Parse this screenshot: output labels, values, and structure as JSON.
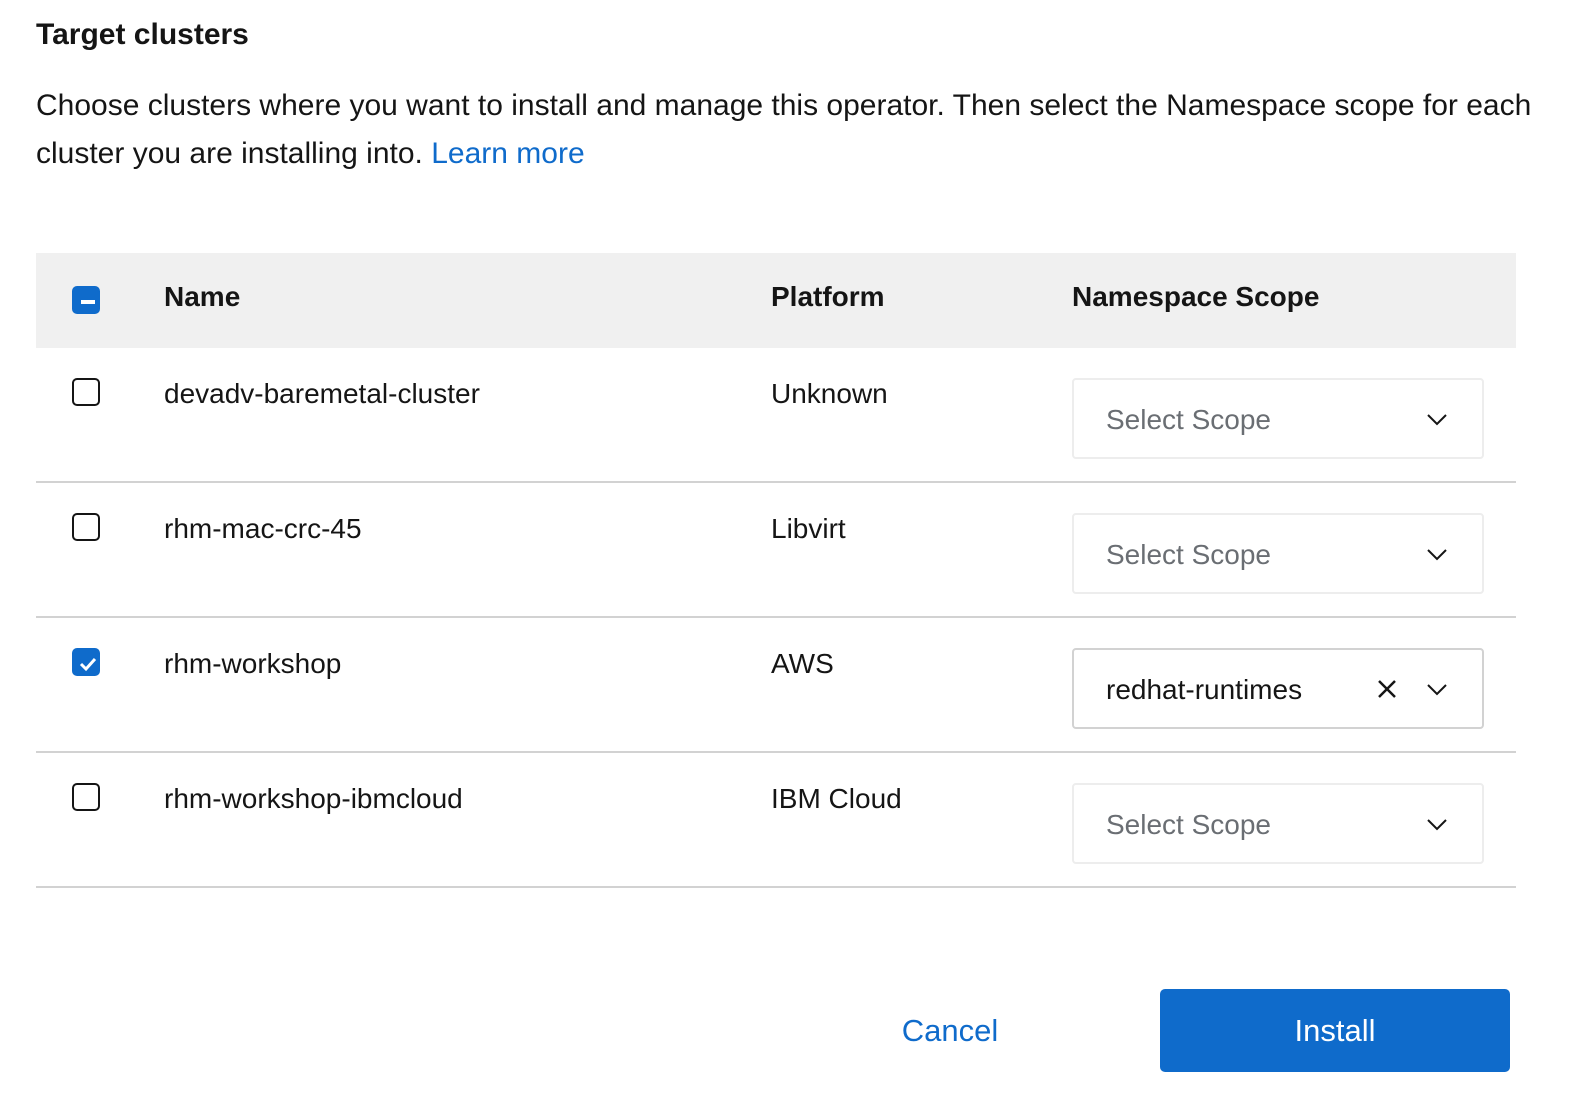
{
  "section": {
    "title": "Target clusters",
    "description": "Choose clusters where you want to install and manage this operator. Then select the Namespace scope for each cluster you are installing into.",
    "learn_more": "Learn more"
  },
  "table": {
    "select_all_state": "indeterminate",
    "headers": {
      "name": "Name",
      "platform": "Platform",
      "scope": "Namespace Scope"
    },
    "rows": [
      {
        "name": "devadv-baremetal-cluster",
        "platform": "Unknown",
        "checked": false,
        "scope": "Select Scope",
        "scope_selected": false
      },
      {
        "name": "rhm-mac-crc-45",
        "platform": "Libvirt",
        "checked": false,
        "scope": "Select Scope",
        "scope_selected": false
      },
      {
        "name": "rhm-workshop",
        "platform": "AWS",
        "checked": true,
        "scope": "redhat-runtimes",
        "scope_selected": true
      },
      {
        "name": "rhm-workshop-ibmcloud",
        "platform": "IBM Cloud",
        "checked": false,
        "scope": "Select Scope",
        "scope_selected": false
      }
    ]
  },
  "actions": {
    "cancel": "Cancel",
    "install": "Install"
  },
  "colors": {
    "accent": "#0f6bcb",
    "header_bg": "#f0f0f0",
    "divider": "#d2d2d2",
    "placeholder": "#6a6e73"
  }
}
